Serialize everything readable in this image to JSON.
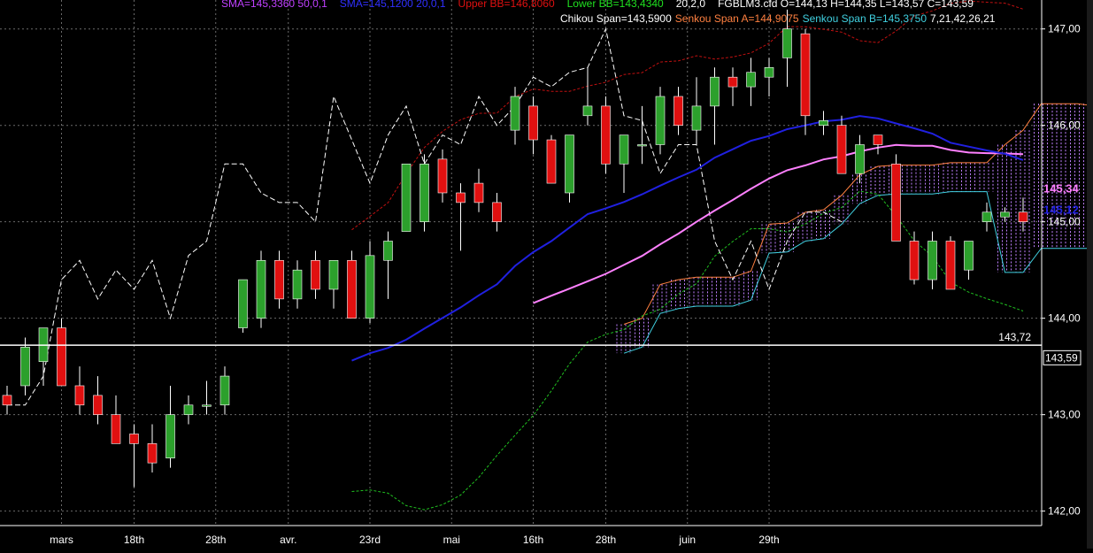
{
  "header": {
    "row1": [
      {
        "text": "SMA=145,3360  50,0,1",
        "color": "#c040ff"
      },
      {
        "text": "SMA=145,1200  20,0,1",
        "color": "#3030ff"
      },
      {
        "text": "Upper BB=146,8060",
        "color": "#e01010"
      },
      {
        "text": "Lower BB=143,4340",
        "color": "#20e020"
      },
      {
        "text": "20,2,0",
        "color": "#ffffff"
      },
      {
        "text": "FGBLM3.cfd O=144,13 H=144,35 L=143,57 C=143,59",
        "color": "#ffffff"
      }
    ],
    "row2": [
      {
        "text": "Chikou Span=143,5900",
        "color": "#ffffff"
      },
      {
        "text": "Senkou Span A=144,9075",
        "color": "#ff8040"
      },
      {
        "text": "Senkou Span B=145,3750",
        "color": "#40d0e0"
      },
      {
        "text": "7,21,42,26,21",
        "color": "#ffffff"
      }
    ]
  },
  "colors": {
    "background": "#000000",
    "grid": "#6a6a6a",
    "up_candle": "#2ca02c",
    "down_candle": "#e01010",
    "wick": "#ffffff",
    "sma50": "#ff80ff",
    "sma20": "#2020e0",
    "upper_bb": "#c01010",
    "lower_bb": "#20c020",
    "chikou": "#ffffff",
    "senkou_a": "#ff8040",
    "senkou_b": "#40d0e0",
    "cloud_fill": "#c080ff",
    "axis_text": "#ffffff"
  },
  "chart_data": {
    "type": "line",
    "symbol": "FGBLM3.cfd",
    "ylim": [
      141.85,
      147.3
    ],
    "xlim": [
      0,
      57.5
    ],
    "yticks": [
      142.0,
      143.0,
      144.0,
      145.0,
      146.0,
      147.0
    ],
    "ytick_labels": [
      "142,00",
      "143,00",
      "144,00",
      "145,00",
      "146,00",
      "147,00"
    ],
    "xticks": [
      {
        "x": 3,
        "label": "mars"
      },
      {
        "x": 7,
        "label": "18th"
      },
      {
        "x": 11.5,
        "label": "28th"
      },
      {
        "x": 15.5,
        "label": "avr."
      },
      {
        "x": 20,
        "label": "23rd"
      },
      {
        "x": 24.5,
        "label": "mai"
      },
      {
        "x": 29,
        "label": "16th"
      },
      {
        "x": 33,
        "label": "28th"
      },
      {
        "x": 37.5,
        "label": "juin"
      },
      {
        "x": 42,
        "label": "29th"
      }
    ],
    "grid": true,
    "price_markers": [
      {
        "value": 145.34,
        "label": "145,34",
        "color": "#ff80ff"
      },
      {
        "value": 145.12,
        "label": "145,12",
        "color": "#2020e0"
      },
      {
        "value": 143.59,
        "label": "143,59",
        "color": "#ffffff",
        "boxed": true
      }
    ],
    "hline": {
      "value": 143.72,
      "label": "143,72"
    },
    "candles": [
      {
        "x": 0,
        "o": 143.2,
        "h": 143.3,
        "l": 143.0,
        "c": 143.1
      },
      {
        "x": 1,
        "o": 143.3,
        "h": 143.8,
        "l": 143.2,
        "c": 143.7
      },
      {
        "x": 2,
        "o": 143.55,
        "h": 143.9,
        "l": 143.3,
        "c": 143.9
      },
      {
        "x": 3,
        "o": 143.9,
        "h": 144.0,
        "l": 143.3,
        "c": 143.3
      },
      {
        "x": 4,
        "o": 143.3,
        "h": 143.5,
        "l": 143.0,
        "c": 143.1
      },
      {
        "x": 5,
        "o": 143.2,
        "h": 143.4,
        "l": 142.9,
        "c": 143.0
      },
      {
        "x": 6,
        "o": 143.0,
        "h": 143.2,
        "l": 142.7,
        "c": 142.7
      },
      {
        "x": 7,
        "o": 142.8,
        "h": 142.9,
        "l": 142.25,
        "c": 142.7
      },
      {
        "x": 8,
        "o": 142.7,
        "h": 142.9,
        "l": 142.4,
        "c": 142.5
      },
      {
        "x": 9,
        "o": 142.55,
        "h": 143.3,
        "l": 142.45,
        "c": 143.0
      },
      {
        "x": 10,
        "o": 143.0,
        "h": 143.2,
        "l": 142.9,
        "c": 143.1
      },
      {
        "x": 11,
        "o": 143.1,
        "h": 143.35,
        "l": 143.0,
        "c": 143.1
      },
      {
        "x": 12,
        "o": 143.1,
        "h": 143.5,
        "l": 143.0,
        "c": 143.4
      },
      {
        "x": 13,
        "o": 143.9,
        "h": 144.4,
        "l": 143.85,
        "c": 144.4
      },
      {
        "x": 14,
        "o": 144.0,
        "h": 144.7,
        "l": 143.9,
        "c": 144.6
      },
      {
        "x": 15,
        "o": 144.6,
        "h": 144.7,
        "l": 144.1,
        "c": 144.2
      },
      {
        "x": 16,
        "o": 144.2,
        "h": 144.6,
        "l": 144.1,
        "c": 144.5
      },
      {
        "x": 17,
        "o": 144.6,
        "h": 144.7,
        "l": 144.2,
        "c": 144.3
      },
      {
        "x": 18,
        "o": 144.3,
        "h": 144.6,
        "l": 144.1,
        "c": 144.6
      },
      {
        "x": 19,
        "o": 144.6,
        "h": 144.7,
        "l": 144.0,
        "c": 144.0
      },
      {
        "x": 20,
        "o": 144.0,
        "h": 144.8,
        "l": 143.95,
        "c": 144.65
      },
      {
        "x": 21,
        "o": 144.6,
        "h": 144.9,
        "l": 144.2,
        "c": 144.8
      },
      {
        "x": 22,
        "o": 144.9,
        "h": 145.6,
        "l": 144.9,
        "c": 145.6
      },
      {
        "x": 23,
        "o": 145.0,
        "h": 145.7,
        "l": 144.9,
        "c": 145.6
      },
      {
        "x": 24,
        "o": 145.65,
        "h": 145.75,
        "l": 145.2,
        "c": 145.3
      },
      {
        "x": 25,
        "o": 145.3,
        "h": 145.4,
        "l": 144.7,
        "c": 145.2
      },
      {
        "x": 26,
        "o": 145.4,
        "h": 145.55,
        "l": 145.1,
        "c": 145.2
      },
      {
        "x": 27,
        "o": 145.2,
        "h": 145.3,
        "l": 144.9,
        "c": 145.0
      },
      {
        "x": 28,
        "o": 145.95,
        "h": 146.4,
        "l": 145.8,
        "c": 146.3
      },
      {
        "x": 29,
        "o": 146.2,
        "h": 146.3,
        "l": 145.7,
        "c": 145.85
      },
      {
        "x": 30,
        "o": 145.85,
        "h": 145.9,
        "l": 145.4,
        "c": 145.4
      },
      {
        "x": 31,
        "o": 145.3,
        "h": 145.9,
        "l": 145.2,
        "c": 145.9
      },
      {
        "x": 32,
        "o": 146.1,
        "h": 146.6,
        "l": 146.0,
        "c": 146.2
      },
      {
        "x": 33,
        "o": 146.2,
        "h": 146.3,
        "l": 145.5,
        "c": 145.6
      },
      {
        "x": 34,
        "o": 145.6,
        "h": 145.9,
        "l": 145.3,
        "c": 145.9
      },
      {
        "x": 35,
        "o": 145.8,
        "h": 146.2,
        "l": 145.6,
        "c": 145.8
      },
      {
        "x": 36,
        "o": 145.8,
        "h": 146.4,
        "l": 145.7,
        "c": 146.3
      },
      {
        "x": 37,
        "o": 146.3,
        "h": 146.4,
        "l": 145.9,
        "c": 146.0
      },
      {
        "x": 38,
        "o": 145.95,
        "h": 146.5,
        "l": 145.8,
        "c": 146.2
      },
      {
        "x": 39,
        "o": 146.2,
        "h": 146.6,
        "l": 145.8,
        "c": 146.5
      },
      {
        "x": 40,
        "o": 146.5,
        "h": 146.6,
        "l": 146.2,
        "c": 146.4
      },
      {
        "x": 41,
        "o": 146.4,
        "h": 146.7,
        "l": 146.2,
        "c": 146.55
      },
      {
        "x": 42,
        "o": 146.5,
        "h": 146.7,
        "l": 146.3,
        "c": 146.6
      },
      {
        "x": 43,
        "o": 146.7,
        "h": 147.2,
        "l": 146.4,
        "c": 147.0
      },
      {
        "x": 44,
        "o": 146.95,
        "h": 147.0,
        "l": 145.9,
        "c": 146.1
      },
      {
        "x": 45,
        "o": 146.0,
        "h": 146.15,
        "l": 145.9,
        "c": 146.05
      },
      {
        "x": 46,
        "o": 146.0,
        "h": 146.1,
        "l": 145.5,
        "c": 145.5
      },
      {
        "x": 47,
        "o": 145.5,
        "h": 145.9,
        "l": 145.4,
        "c": 145.8
      },
      {
        "x": 48,
        "o": 145.9,
        "h": 145.9,
        "l": 145.7,
        "c": 145.8
      },
      {
        "x": 49,
        "o": 145.6,
        "h": 145.7,
        "l": 144.8,
        "c": 144.8
      },
      {
        "x": 50,
        "o": 144.8,
        "h": 144.9,
        "l": 144.35,
        "c": 144.4
      },
      {
        "x": 51,
        "o": 144.4,
        "h": 144.9,
        "l": 144.3,
        "c": 144.8
      },
      {
        "x": 52,
        "o": 144.8,
        "h": 144.85,
        "l": 144.3,
        "c": 144.3
      },
      {
        "x": 53,
        "o": 144.5,
        "h": 144.8,
        "l": 144.4,
        "c": 144.8
      },
      {
        "x": 54,
        "o": 145.0,
        "h": 145.2,
        "l": 144.9,
        "c": 145.1
      },
      {
        "x": 55,
        "o": 145.05,
        "h": 145.15,
        "l": 145.0,
        "c": 145.1
      },
      {
        "x": 56,
        "o": 145.1,
        "h": 145.25,
        "l": 144.9,
        "c": 145.0
      }
    ],
    "sma50": [],
    "sma20": [],
    "upper_bb": [],
    "lower_bb": [],
    "chikou": [],
    "senkou_a": [],
    "senkou_b": []
  }
}
